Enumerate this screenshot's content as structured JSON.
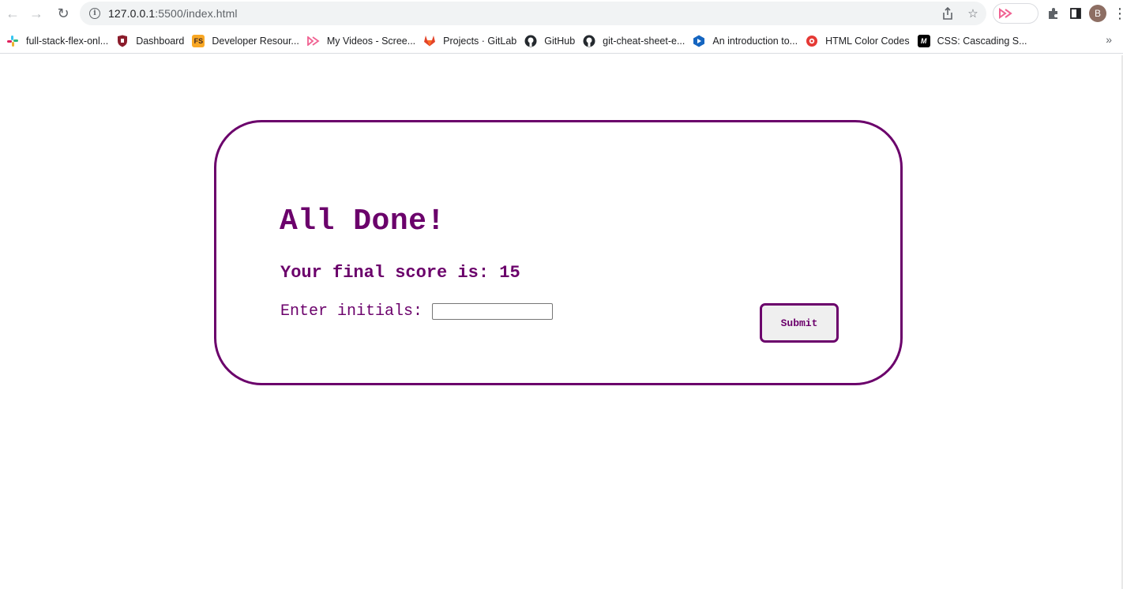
{
  "browser": {
    "url_host": "127.0.0.1",
    "url_rest": ":5500/index.html",
    "avatar_letter": "B"
  },
  "bookmarks": [
    {
      "label": "full-stack-flex-onl...",
      "icon": "slack-icon",
      "color": "#e01e5a"
    },
    {
      "label": "Dashboard",
      "icon": "shield-icon",
      "color": "#8b1d2c"
    },
    {
      "label": "Developer Resour...",
      "icon": "fs-icon",
      "color": "#f9a825"
    },
    {
      "label": "My Videos - Scree...",
      "icon": "screencast-icon",
      "color": "#f06292"
    },
    {
      "label": "Projects · GitLab",
      "icon": "gitlab-icon",
      "color": "#e24329"
    },
    {
      "label": "GitHub",
      "icon": "github-icon",
      "color": "#24292e"
    },
    {
      "label": "git-cheat-sheet-e...",
      "icon": "github-icon",
      "color": "#24292e"
    },
    {
      "label": "An introduction to...",
      "icon": "play-icon",
      "color": "#1565c0"
    },
    {
      "label": "HTML Color Codes",
      "icon": "color-wheel-icon",
      "color": "#e53935"
    },
    {
      "label": "CSS: Cascading S...",
      "icon": "mdn-icon",
      "color": "#000000"
    }
  ],
  "page": {
    "heading": "All Done!",
    "score_text": "Your final score is: 15",
    "initials_label": "Enter initials:",
    "initials_value": "",
    "submit_label": "Submit"
  },
  "colors": {
    "accent": "#6b006b"
  }
}
